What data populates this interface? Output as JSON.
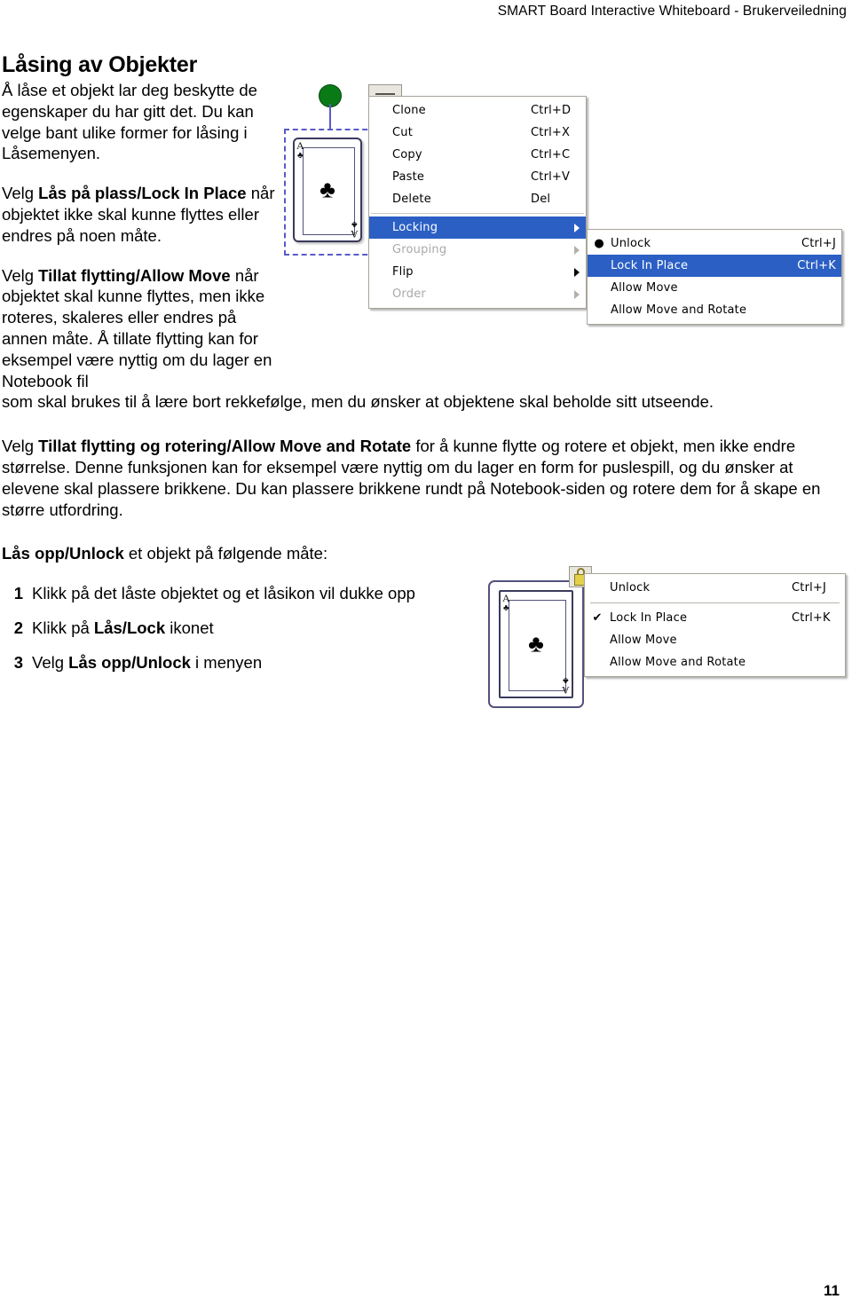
{
  "header": {
    "title": "SMART Board Interactive Whiteboard - Brukerveiledning"
  },
  "footer": {
    "page_number": "11"
  },
  "content": {
    "heading": "Låsing av Objekter",
    "paragraph_1": "Å låse et objekt lar deg beskytte de egenskaper du har gitt det. Du kan velge bant ulike former for låsing i Låsemenyen.",
    "paragraph_2_pre": "Velg ",
    "paragraph_2_bold": "Lås på plass/Lock In Place",
    "paragraph_2_post": " når objektet ikke skal kunne flyttes eller endres på noen måte.",
    "paragraph_3_pre": "Velg ",
    "paragraph_3_bold": "Tillat flytting/Allow Move",
    "paragraph_3_post": " når objektet skal kunne flyttes, men ikke roteres, skaleres eller endres på annen måte. Å tillate flytting kan for eksempel være nyttig om du lager en Notebook fil",
    "paragraph_3_wide": "som skal brukes til å lære bort rekkefølge, men du ønsker at objektene skal beholde sitt utseende.",
    "paragraph_4_pre": "Velg ",
    "paragraph_4_bold": "Tillat flytting og rotering/Allow Move and Rotate",
    "paragraph_4_post": " for å kunne flytte og rotere et objekt, men ikke endre størrelse. Denne funksjonen kan for eksempel være nyttig om du lager en form for puslespill, og du ønsker at elevene skal plassere brikkene. Du kan plassere brikkene rundt på Notebook-siden og rotere dem for å skape en større utfordring.",
    "unlock_intro_bold": "Lås opp/Unlock",
    "unlock_intro_post": " et objekt på følgende måte:",
    "steps": [
      {
        "num": "1",
        "pre": "Klikk på det låste objektet og et låsikon vil dukke opp",
        "bold": "",
        "post": ""
      },
      {
        "num": "2",
        "pre": "Klikk på ",
        "bold": "Lås/Lock",
        "post": " ikonet"
      },
      {
        "num": "3",
        "pre": "Velg ",
        "bold": "Lås opp/Unlock",
        "post": " i menyen"
      }
    ]
  },
  "figure_context_menu": {
    "card": {
      "rank": "A",
      "suit": "♣"
    },
    "main_menu": [
      {
        "label": "Clone",
        "accel": "Ctrl+D",
        "state": "normal",
        "submenu": false,
        "bullet": ""
      },
      {
        "label": "Cut",
        "accel": "Ctrl+X",
        "state": "normal",
        "submenu": false,
        "bullet": ""
      },
      {
        "label": "Copy",
        "accel": "Ctrl+C",
        "state": "normal",
        "submenu": false,
        "bullet": ""
      },
      {
        "label": "Paste",
        "accel": "Ctrl+V",
        "state": "normal",
        "submenu": false,
        "bullet": ""
      },
      {
        "label": "Delete",
        "accel": "Del",
        "state": "normal",
        "submenu": false,
        "bullet": ""
      },
      {
        "label": "Locking",
        "accel": "",
        "state": "selected",
        "submenu": true,
        "bullet": ""
      },
      {
        "label": "Grouping",
        "accel": "",
        "state": "disabled",
        "submenu": true,
        "bullet": ""
      },
      {
        "label": "Flip",
        "accel": "",
        "state": "normal",
        "submenu": true,
        "bullet": ""
      },
      {
        "label": "Order",
        "accel": "",
        "state": "disabled",
        "submenu": true,
        "bullet": ""
      }
    ],
    "submenu": [
      {
        "label": "Unlock",
        "accel": "Ctrl+J",
        "state": "normal",
        "bullet": "●"
      },
      {
        "label": "Lock In Place",
        "accel": "Ctrl+K",
        "state": "selected",
        "bullet": ""
      },
      {
        "label": "Allow Move",
        "accel": "",
        "state": "normal",
        "bullet": ""
      },
      {
        "label": "Allow Move and Rotate",
        "accel": "",
        "state": "normal",
        "bullet": ""
      }
    ]
  },
  "figure_unlock_menu": {
    "card": {
      "rank": "A",
      "suit": "♣"
    },
    "menu": [
      {
        "label": "Unlock",
        "accel": "Ctrl+J",
        "state": "normal",
        "bullet": ""
      },
      {
        "label": "Lock In Place",
        "accel": "Ctrl+K",
        "state": "normal",
        "bullet": "✔"
      },
      {
        "label": "Allow Move",
        "accel": "",
        "state": "normal",
        "bullet": ""
      },
      {
        "label": "Allow Move and Rotate",
        "accel": "",
        "state": "normal",
        "bullet": ""
      }
    ]
  },
  "colors": {
    "menu_highlight": "#2b5fc4",
    "selection_dash": "#5a5ac8",
    "rotate_handle": "#0a7a17",
    "lock_icon": "#e4d14a"
  }
}
